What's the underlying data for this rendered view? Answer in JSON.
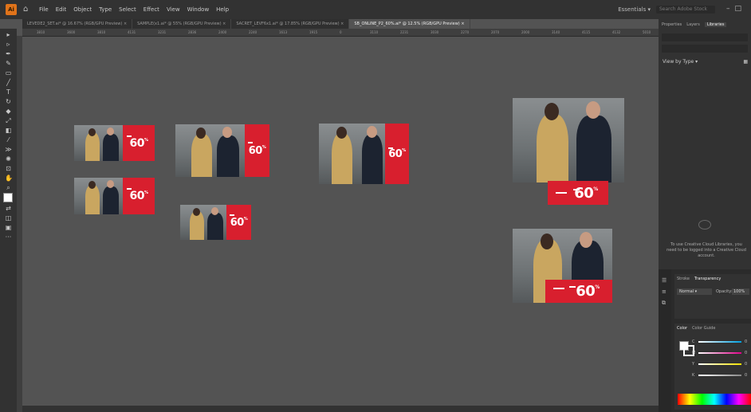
{
  "app": {
    "logo": "Ai",
    "home_icon": "home-icon"
  },
  "menu": [
    "File",
    "Edit",
    "Object",
    "Type",
    "Select",
    "Effect",
    "View",
    "Window",
    "Help"
  ],
  "workspace": "Essentials",
  "search_placeholder": "Search Adobe Stock",
  "tabs": [
    {
      "label": "LEVEDE2_SET.ai* @ 16.67% (RGB/GPU Preview)",
      "active": false
    },
    {
      "label": "SAMPLE(x1.ai* @ 55% (RGB/GPU Preview)",
      "active": false
    },
    {
      "label": "SACRET_LEVF6x1.ai* @ 17.85% (RGB/GPU Preview)",
      "active": false
    },
    {
      "label": "SB_ONLINE_P2_60%.ai* @ 12.5% (RGB/GPU Preview)",
      "active": true
    }
  ],
  "ruler_ticks": [
    "3810",
    "3600",
    "3810",
    "4131",
    "3231",
    "2836",
    "2400",
    "2240",
    "1613",
    "1915",
    "0",
    "3110",
    "2231",
    "3030",
    "2270",
    "2070",
    "2000",
    "3140",
    "4115",
    "4132",
    "5010"
  ],
  "banner": {
    "discount": "60",
    "percent": "%"
  },
  "panel": {
    "tabs": [
      "Properties",
      "Layers",
      "Libraries"
    ],
    "active_tab": "Libraries",
    "view_by": "View by Type",
    "cc_message": "To use Creative Cloud Libraries, you need to be logged into a Creative Cloud account."
  },
  "transparency": {
    "tabs": [
      "Stroke",
      "Transparency"
    ],
    "blend_mode": "Normal",
    "opacity_label": "Opacity:",
    "opacity_value": "100%"
  },
  "color": {
    "tabs": [
      "Color",
      "Color Guide"
    ],
    "channels": [
      {
        "label": "C",
        "value": "0",
        "color": "#00a0e0"
      },
      {
        "label": "M",
        "value": "0",
        "color": "#e0008a"
      },
      {
        "label": "Y",
        "value": "0",
        "color": "#f0e000"
      },
      {
        "label": "K",
        "value": "0",
        "color": "#888888"
      }
    ]
  },
  "colors": {
    "accent": "#d81f2e",
    "bg": "#535353",
    "chrome": "#323232"
  }
}
